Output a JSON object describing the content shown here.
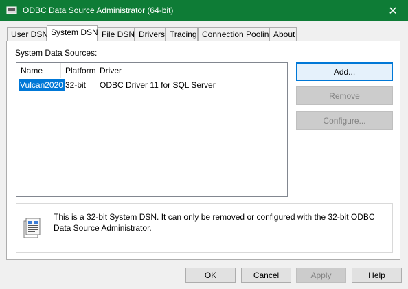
{
  "window": {
    "title": "ODBC Data Source Administrator (64-bit)",
    "close_glyph": "✕",
    "title_bar_color": "#0e7c36"
  },
  "tabs": [
    {
      "label": "User DSN",
      "active": false
    },
    {
      "label": "System DSN",
      "active": true
    },
    {
      "label": "File DSN",
      "active": false
    },
    {
      "label": "Drivers",
      "active": false
    },
    {
      "label": "Tracing",
      "active": false
    },
    {
      "label": "Connection Pooling",
      "active": false
    },
    {
      "label": "About",
      "active": false
    }
  ],
  "section_label": "System Data Sources:",
  "list": {
    "columns": [
      "Name",
      "Platform",
      "Driver"
    ],
    "rows": [
      {
        "name": "Vulcan2020",
        "platform": "32-bit",
        "driver": "ODBC Driver 11 for SQL Server",
        "selected": true
      }
    ]
  },
  "side_buttons": {
    "add": "Add...",
    "remove": "Remove",
    "configure": "Configure..."
  },
  "info": {
    "icon": "dsn-document-icon",
    "text": "This is a 32-bit System DSN. It can only be removed or configured with the 32-bit ODBC Data Source Administrator."
  },
  "footer": {
    "ok": "OK",
    "cancel": "Cancel",
    "apply": "Apply",
    "help": "Help"
  },
  "colors": {
    "selection": "#0078d7",
    "default_button_border": "#0078d7"
  }
}
